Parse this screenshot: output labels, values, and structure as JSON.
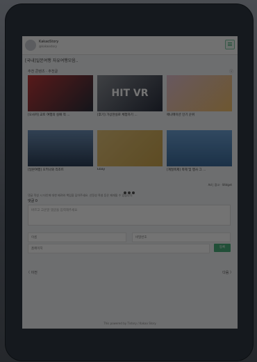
{
  "header": {
    "app_title": "KakaoStory",
    "app_sub": "@kakaostory"
  },
  "page_title": "[국내]일본여행 자유여행모음..",
  "section": {
    "label": "추천 콘텐츠 · 추천글",
    "close": "ⓧ"
  },
  "cards": [
    {
      "caption": "[오사카] 교토 여행의 실패 적 ...",
      "colors": [
        "#c23a3a",
        "#2b2f3a"
      ]
    },
    {
      "caption": "[후기] 가상현실로 체험하기 ...",
      "colors": [
        "#8b8f96",
        "#2b3140"
      ],
      "text": "HIT VR"
    },
    {
      "caption": "애니메이션 인기 순위",
      "colors": [
        "#e6c3d3",
        "#f3c26b"
      ]
    },
    {
      "caption": "[일본여행] 오키나와 리조트",
      "colors": [
        "#4f78a8",
        "#2d4058"
      ]
    },
    {
      "caption": "Ebay",
      "colors": [
        "#e5c47a",
        "#cfa84f"
      ]
    },
    {
      "caption": "[계절축제] 축제 및 행사 그 ...",
      "colors": [
        "#6da2d6",
        "#3d6d9e"
      ]
    }
  ],
  "ad_brand": "Ad | 광고 · Widget",
  "notice": "댓글 작성 시 타인에 대한 배려와 책임을 담아주세요. 선정성 욕설 등은 제재될 수 있습니다.",
  "comments": {
    "title": "댓글 0",
    "placeholder": "바르고 고운말 댓글을 입력해주세요",
    "name_placeholder": "이름",
    "password_placeholder": "비밀번호",
    "site_placeholder": "홈페이지",
    "submit_label": "등록"
  },
  "pager": {
    "prev": "〈 이전",
    "next": "다음 〉"
  },
  "footer": "This powered by Tistory / Kakao Story"
}
